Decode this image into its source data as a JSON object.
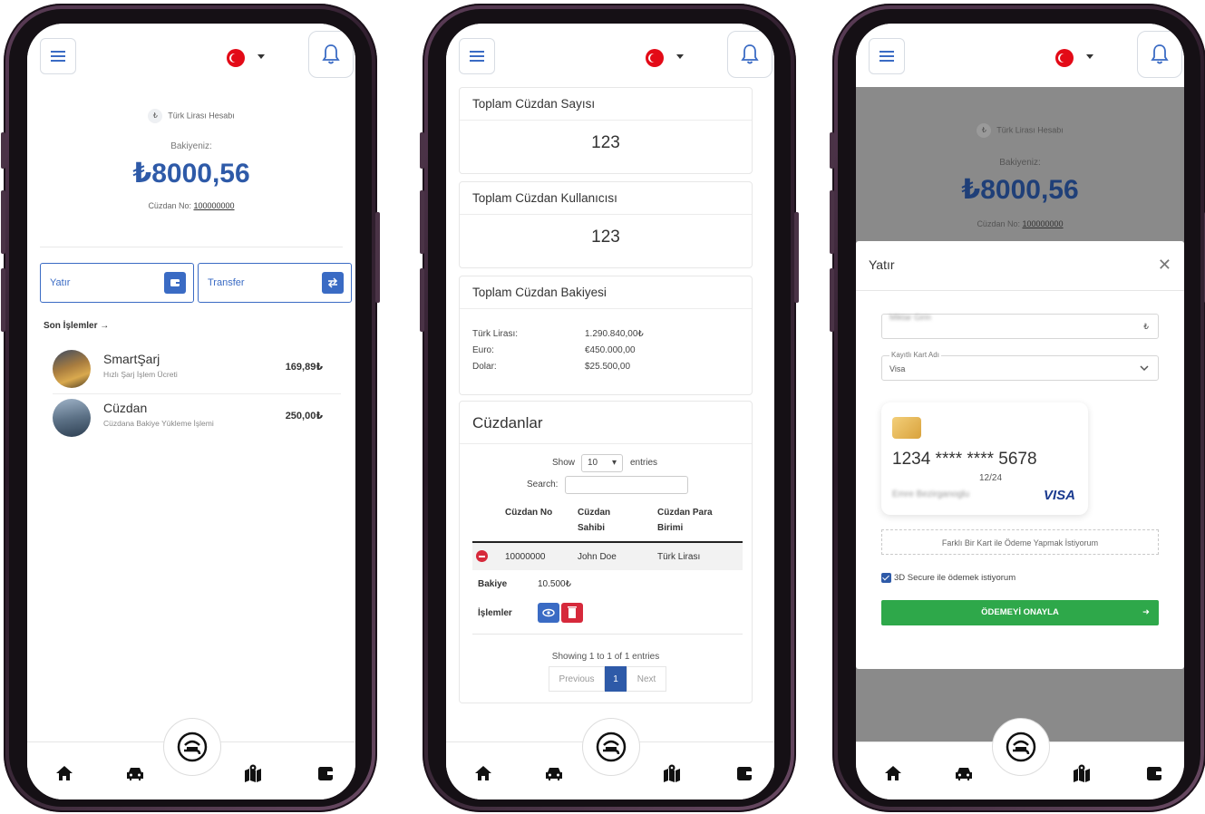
{
  "common": {
    "caret": "▾"
  },
  "phone1": {
    "account_label": "Türk Lirası Hesabı",
    "lira_symbol": "₺",
    "balance_label": "Bakiyeniz:",
    "balance_value": "₺8000,56",
    "wallet_no_label": "Cüzdan No:",
    "wallet_no_value": "100000000",
    "deposit_label": "Yatır",
    "transfer_label": "Transfer",
    "recent_title": "Son İşlemler →",
    "transactions": [
      {
        "name": "SmartŞarj",
        "desc": "Hızlı Şarj İşlem Ücreti",
        "amount": "169,89₺"
      },
      {
        "name": "Cüzdan",
        "desc": "Cüzdana Bakiye Yükleme İşlemi",
        "amount": "250,00₺"
      }
    ]
  },
  "phone2": {
    "total_wallets_title": "Toplam Cüzdan Sayısı",
    "total_wallets_value": "123",
    "total_users_title": "Toplam Cüzdan Kullanıcısı",
    "total_users_value": "123",
    "total_balance_title": "Toplam Cüzdan Bakiyesi",
    "balances": [
      {
        "k": "Türk Lirası:",
        "v": "1.290.840,00₺"
      },
      {
        "k": "Euro:",
        "v": "€450.000,00"
      },
      {
        "k": "Dolar:",
        "v": "$25.500,00"
      }
    ],
    "wallets_title": "Cüzdanlar",
    "show_label": "Show",
    "show_value": "10",
    "entries_label": "entries",
    "search_label": "Search:",
    "columns": [
      "Cüzdan No",
      "Cüzdan Sahibi",
      "Cüzdan Para Birimi"
    ],
    "row": {
      "no": "10000000",
      "owner": "John Doe",
      "currency": "Türk Lirası"
    },
    "balance_key": "Bakiye",
    "balance_val": "10.500₺",
    "actions_key": "İşlemler",
    "info": "Showing 1 to 1 of 1 entries",
    "prev": "Previous",
    "page": "1",
    "next": "Next"
  },
  "phone3": {
    "account_label": "Türk Lirası Hesabı",
    "lira_symbol": "₺",
    "balance_label": "Bakiyeniz:",
    "balance_value": "₺8000,56",
    "wallet_no_label": "Cüzdan No:",
    "wallet_no_value": "100000000",
    "modal_title": "Yatır",
    "amount_blurred": "Miktar Girin",
    "card_select_label": "Kayıtlı Kart Adı",
    "card_select_value": "Visa",
    "card_number": "1234 **** **** 5678",
    "card_expiry": "12/24",
    "card_holder_blurred": "Emre Bezirganoglu",
    "card_brand": "VISA",
    "alt_pay": "Farklı Bir Kart ile Ödeme Yapmak İstiyorum",
    "secure_label": "3D Secure ile ödemek istiyorum",
    "confirm_label": "ÖDEMEYİ ONAYLA",
    "confirm_arrow": "➜"
  },
  "colors": {
    "accent": "#2e5aa8",
    "success": "#2ea84a",
    "danger": "#d6293b"
  }
}
